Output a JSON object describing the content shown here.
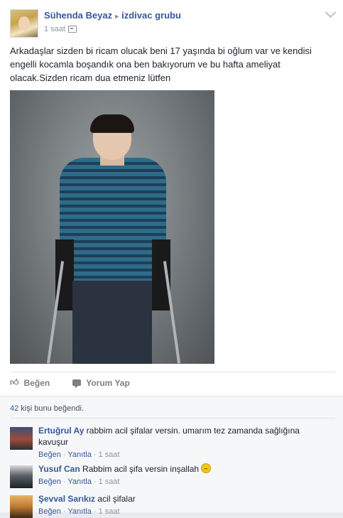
{
  "post": {
    "author": "Sühenda Beyaz",
    "separator": "▸",
    "group": "izdivac grubu",
    "time": "1 saat",
    "text": "Arkadaşlar sizden bi ricam olucak beni 17 yaşında bi oğlum var ve kendisi engelli kocamla boşandık ona ben bakıyorum ve bu hafta ameliyat olacak.Sizden ricam dua etmeniz lütfen"
  },
  "actions": {
    "like_label": "Beğen",
    "comment_label": "Yorum Yap"
  },
  "likes": {
    "count": "42",
    "suffix": " kişi bunu beğendi."
  },
  "comments": [
    {
      "name": "Ertuğrul Ay",
      "text": " rabbim acil şifalar versin. umarım tez zamanda sağlığına kavuşur",
      "like": "Beğen",
      "dot": " · ",
      "reply": "Yanıtla",
      "time": "1 saat"
    },
    {
      "name": "Yusuf Can",
      "text": " Rabbim acil şifa versin inşallah ",
      "like": "Beğen",
      "dot": " · ",
      "reply": "Yanıtla",
      "time": "1 saat"
    },
    {
      "name": "Şevval Sarıkız",
      "text": " acil şifalar",
      "like": "Beğen",
      "dot": " · ",
      "reply": "Yanıtla",
      "time": "1 saat"
    }
  ]
}
